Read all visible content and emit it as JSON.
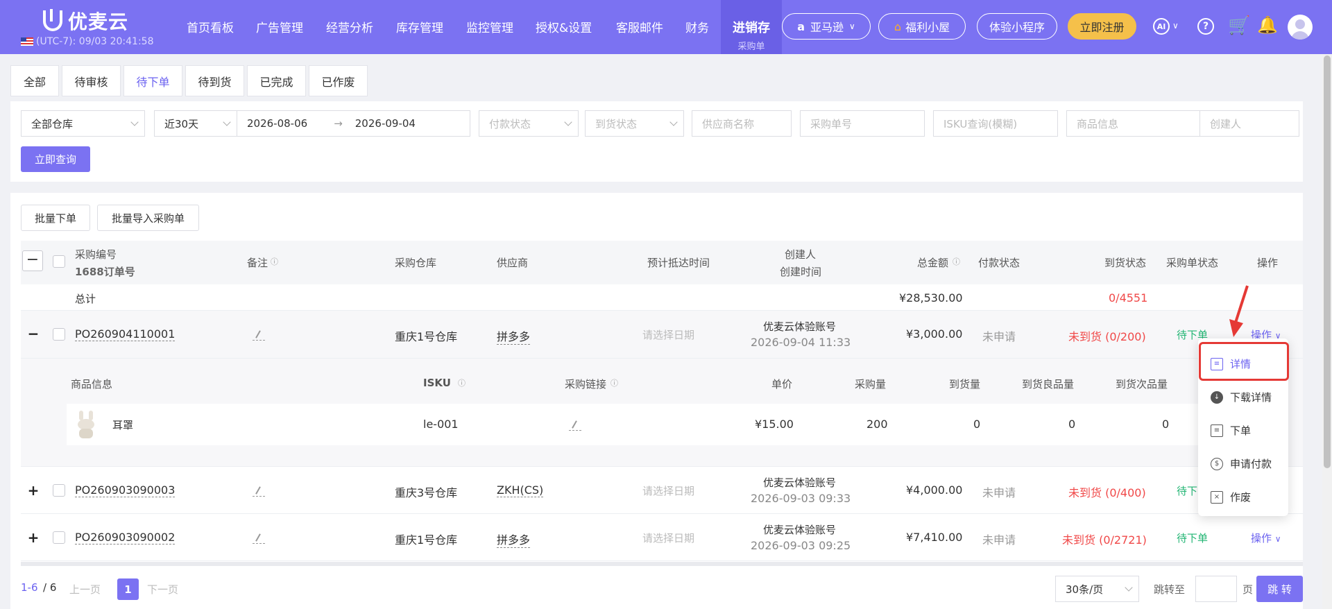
{
  "header": {
    "brand": "优麦云",
    "timezone": "(UTC-7): 09/03 20:41:58",
    "nav": [
      "首页看板",
      "广告管理",
      "经营分析",
      "库存管理",
      "监控管理",
      "授权&设置",
      "客服邮件",
      "财务"
    ],
    "active_nav": "进销存",
    "active_sub": "采购单",
    "store": "亚马逊",
    "welfare": "福利小屋",
    "mini": "体验小程序",
    "register": "立即注册",
    "ai": "AI",
    "help": "?"
  },
  "tabs": [
    "全部",
    "待审核",
    "待下单",
    "待到货",
    "已完成",
    "已作废"
  ],
  "active_tab": "待下单",
  "filters": {
    "warehouse": "全部仓库",
    "range": "近30天",
    "date_from": "2026-08-06",
    "date_to": "2026-09-04",
    "arrow": "→",
    "pay_status": "付款状态",
    "arrive_status": "到货状态",
    "supplier": "供应商名称",
    "po_no": "采购单号",
    "isku": "ISKU查询(模糊)",
    "product": "商品信息",
    "creator": "创建人",
    "query_btn": "立即查询"
  },
  "actions": {
    "batch_order": "批量下单",
    "batch_import": "批量导入采购单"
  },
  "table": {
    "headers": {
      "po_no": "采购编号",
      "order_1688": "1688订单号",
      "remark": "备注",
      "warehouse": "采购仓库",
      "supplier": "供应商",
      "eta": "预计抵达时间",
      "creator": "创建人",
      "created": "创建时间",
      "total": "总金额",
      "pay": "付款状态",
      "arrive": "到货状态",
      "po_status": "采购单状态",
      "op": "操作"
    },
    "total_label": "总计",
    "total_amount": "¥28,530.00",
    "total_arrive": "0/4551",
    "rows": [
      {
        "expand": "−",
        "po": "PO260904110001",
        "wh": "重庆1号仓库",
        "sup": "拼多多",
        "eta": "请选择日期",
        "creator": "优麦云体验账号",
        "created": "2026-09-04 11:33",
        "amount": "¥3,000.00",
        "pay": "未申请",
        "arrive": "未到货 (0/200)",
        "status": "待下单",
        "op": "操作"
      },
      {
        "expand": "+",
        "po": "PO260903090003",
        "wh": "重庆3号仓库",
        "sup": "ZKH(CS)",
        "eta": "请选择日期",
        "creator": "优麦云体验账号",
        "created": "2026-09-03 09:33",
        "amount": "¥4,000.00",
        "pay": "未申请",
        "arrive": "未到货 (0/400)",
        "status": "待下"
      },
      {
        "expand": "+",
        "po": "PO260903090002",
        "wh": "重庆1号仓库",
        "sup": "拼多多",
        "eta": "请选择日期",
        "creator": "优麦云体验账号",
        "created": "2026-09-03 09:25",
        "amount": "¥7,410.00",
        "pay": "未申请",
        "arrive": "未到货 (0/2721)",
        "status": "待下单",
        "op": "操作"
      }
    ],
    "sub": {
      "headers": {
        "product": "商品信息",
        "isku": "ISKU",
        "link": "采购链接",
        "price": "单价",
        "qty": "采购量",
        "arrived": "到货量",
        "good": "到货良品量",
        "bad": "到货次品量"
      },
      "row": {
        "name": "耳罩",
        "isku": "le-001",
        "price": "¥15.00",
        "qty": "200",
        "arrived": "0",
        "good": "0",
        "bad": "0"
      }
    }
  },
  "menu": [
    "详情",
    "下载详情",
    "下单",
    "申请付款",
    "作废"
  ],
  "pager": {
    "range": "1-6",
    "total": "6",
    "prev": "上一页",
    "page": "1",
    "next": "下一页",
    "size": "30条/页",
    "jump_label": "跳转至",
    "page_unit": "页",
    "jump_btn": "跳 转"
  },
  "colors": {
    "brand": "#7b72f2",
    "highlight": "#e53935"
  }
}
